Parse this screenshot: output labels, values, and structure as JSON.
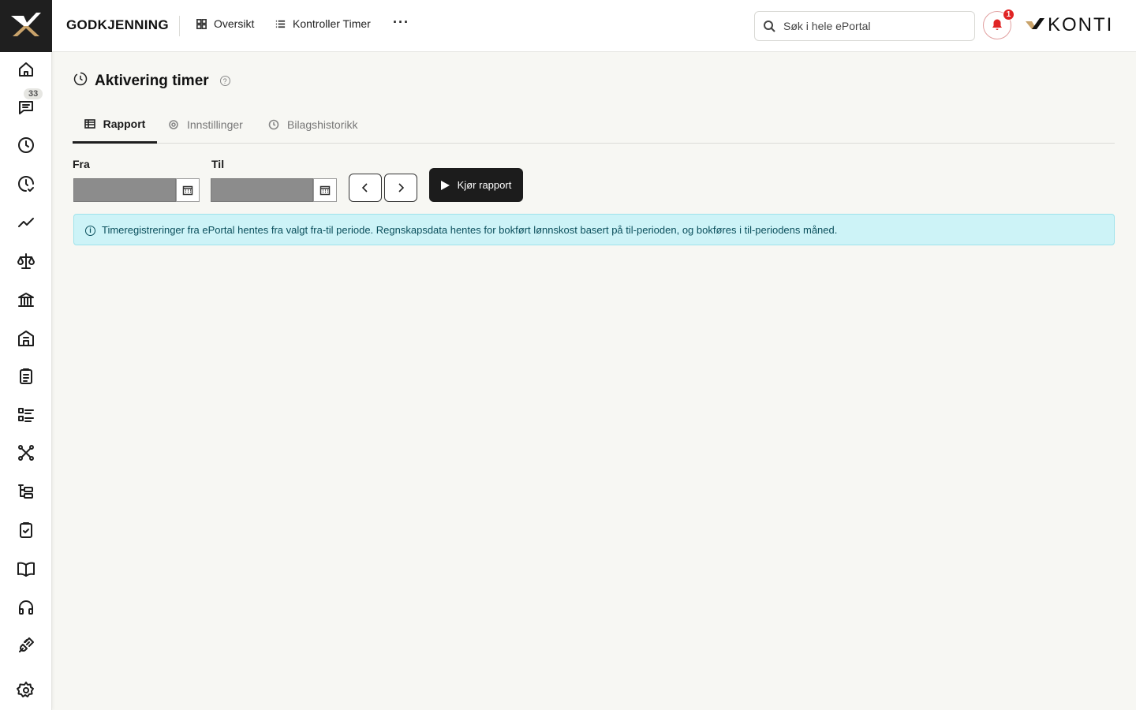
{
  "header": {
    "app_title": "GODKJENNING",
    "links": [
      {
        "label": "Oversikt",
        "icon": "grid-icon"
      },
      {
        "label": "Kontroller Timer",
        "icon": "list-icon"
      }
    ],
    "more_label": "···",
    "search_placeholder": "Søk i hele ePortal",
    "notification_count": "1",
    "logo_text": "KONTI"
  },
  "sidebar": {
    "items": [
      {
        "name": "home-icon"
      },
      {
        "name": "messages-icon",
        "badge": "33"
      },
      {
        "name": "clock-icon"
      },
      {
        "name": "clock-check-icon"
      },
      {
        "name": "trend-icon"
      },
      {
        "name": "scale-icon"
      },
      {
        "name": "bank-icon"
      },
      {
        "name": "building-icon"
      },
      {
        "name": "clipboard-list-icon"
      },
      {
        "name": "checklist-icon"
      },
      {
        "name": "network-icon"
      },
      {
        "name": "tree-icon"
      },
      {
        "name": "clipboard-check-icon"
      },
      {
        "name": "book-icon"
      },
      {
        "name": "headset-icon"
      },
      {
        "name": "plug-icon"
      },
      {
        "name": "settings-icon"
      }
    ]
  },
  "page": {
    "title": "Aktivering timer",
    "tabs": [
      {
        "label": "Rapport",
        "active": true
      },
      {
        "label": "Innstillinger",
        "active": false
      },
      {
        "label": "Bilagshistorikk",
        "active": false
      }
    ],
    "from_label": "Fra",
    "to_label": "Til",
    "run_button": "Kjør rapport",
    "info_text": "Timeregistreringer fra ePortal hentes fra valgt fra-til periode. Regnskapsdata hentes for bokført lønnskost basert på til-perioden, og bokføres i til-periodens måned."
  },
  "colors": {
    "accent_dark": "#1c1c1c",
    "alert_bg": "#cdf3f7",
    "notification_red": "#e02424",
    "logo_gold": "#c9a36b"
  }
}
